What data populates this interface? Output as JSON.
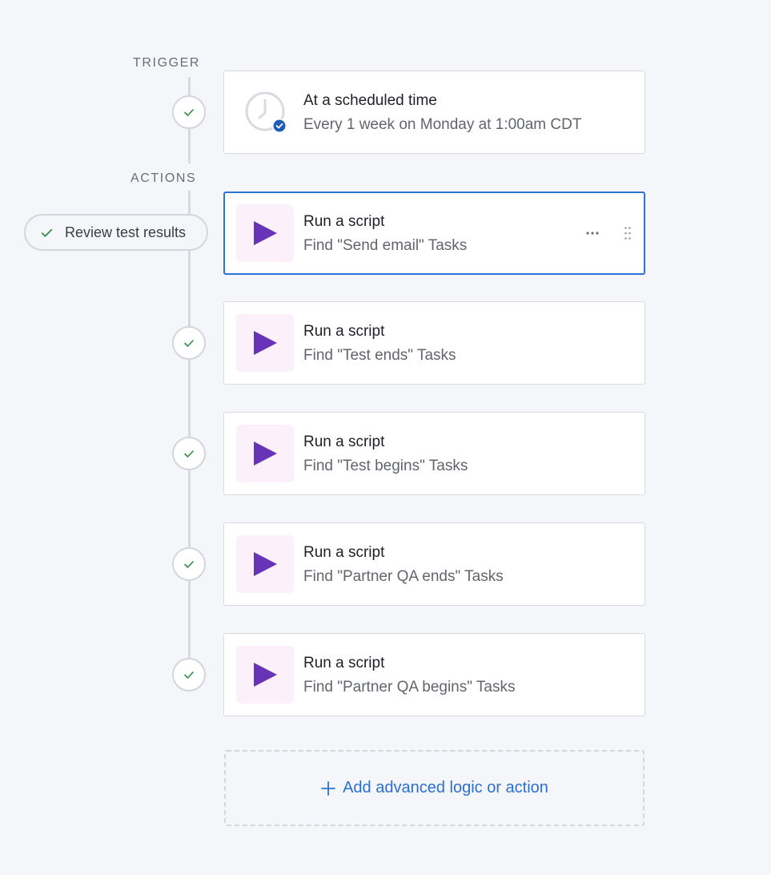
{
  "trigger": {
    "section_label": "TRIGGER",
    "title": "At a scheduled time",
    "subtitle": "Every 1 week on Monday at 1:00am CDT",
    "icon": "clock-icon",
    "badge_icon": "check-badge-icon"
  },
  "actions": {
    "section_label": "ACTIONS",
    "review_pill": "Review test results",
    "items": [
      {
        "title": "Run a script",
        "subtitle": "Find \"Send email\" Tasks",
        "selected": true
      },
      {
        "title": "Run a script",
        "subtitle": "Find \"Test ends\" Tasks",
        "selected": false
      },
      {
        "title": "Run a script",
        "subtitle": "Find \"Test begins\" Tasks",
        "selected": false
      },
      {
        "title": "Run a script",
        "subtitle": "Find \"Partner QA ends\" Tasks",
        "selected": false
      },
      {
        "title": "Run a script",
        "subtitle": "Find \"Partner QA begins\" Tasks",
        "selected": false
      }
    ],
    "item_icon": "play-icon"
  },
  "add_action": {
    "label": "Add advanced logic or action",
    "icon": "plus-icon"
  },
  "colors": {
    "accent": "#2b73d6",
    "play": "#6834b7",
    "check": "#2f8a44",
    "tile_bg": "#fcf0fa"
  }
}
